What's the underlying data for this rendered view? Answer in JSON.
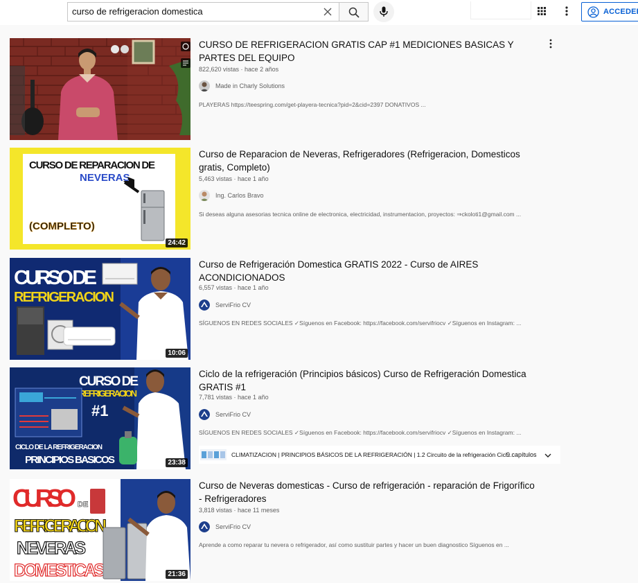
{
  "search": {
    "query": "curso de refrigeracion domestica"
  },
  "icons": {
    "clear": "close-icon",
    "search": "search-icon",
    "mic": "mic-icon",
    "apps": "apps-grid-icon",
    "more": "more-vert-icon",
    "account": "account-circle-icon"
  },
  "header": {
    "signin_label": "ACCEDER"
  },
  "colors": {
    "accent": "#065fd4",
    "meta": "#606060",
    "background": "#f9f9f9"
  },
  "results": [
    {
      "title": "CURSO DE REFRIGERACION GRATIS CAP #1 MEDICIONES BASICAS Y PARTES DEL EQUIPO",
      "views": "822,620 vistas",
      "age": "hace 2 años",
      "channel": "Made in Charly Solutions",
      "description": "PLAYERAS https://teespring.com/get-playera-tecnica?pid=2&cid=2397 DONATIVOS ...",
      "duration": ""
    },
    {
      "title": "Curso de Reparacion de Neveras, Refrigeradores (Refrigeracion, Domesticos gratis, Completo)",
      "views": "5,463 vistas",
      "age": "hace 1 año",
      "channel": "Ing. Carlos Bravo",
      "description": "Si deseas alguna asesorias tecnica online de electronica, electricidad, instrumentacion, proyectos: ⇒ckoloti1@gmail.com ...",
      "duration": "24:42",
      "thumb_text": {
        "line1": "CURSO DE REPARACION DE",
        "line2": "NEVERAS",
        "line3": "(COMPLETO)"
      }
    },
    {
      "title": "Curso de Refrigeración Domestica GRATIS 2022 - Curso de AIRES ACONDICIONADOS",
      "views": "6,557 vistas",
      "age": "hace 1 año",
      "channel": "ServiFrio CV",
      "description": "SÍGUENOS EN REDES SOCIALES ✓Síguenos en Facebook: https://facebook.com/servifriocv ✓Síguenos en Instagram: ...",
      "duration": "10:06",
      "thumb_text": {
        "line1": "CURSO DE",
        "line2": "REFRIGERACION"
      }
    },
    {
      "title": "Ciclo de la refrigeración (Principios básicos) Curso de Refrigeración Domestica GRATIS #1",
      "views": "7,781 vistas",
      "age": "hace 1 año",
      "channel": "ServiFrio CV",
      "description": "SÍGUENOS EN REDES SOCIALES ✓Síguenos en Facebook: https://facebook.com/servifriocv ✓Síguenos en Instagram: ...",
      "duration": "23:38",
      "chapters_text": "CLIMATIZACION | PRINCIPIOS BÁSICOS DE LA REFRIGERACIÓN | 1.2 Circuito de la refrigeración Cicl...",
      "chapters_count": "9 capítulos",
      "thumb_text": {
        "line1": "CURSO DE",
        "line2": "REFRIGERACION",
        "line3": "#1",
        "line4": "CICLO DE LA REFRIGERACION",
        "line5": "PRINCIPIOS BASICOS"
      }
    },
    {
      "title": "Curso de Neveras domesticas - Curso de refrigeración - reparación de Frigorífico - Refrigeradores",
      "views": "3,818 vistas",
      "age": "hace 11 meses",
      "channel": "ServiFrio CV",
      "description": "Aprende a como reparar tu nevera o refrigerador, así como sustituir partes y hacer un buen diagnostico Síguenos en ...",
      "duration": "21:36",
      "thumb_text": {
        "line1": "CURSO",
        "line2": "DE",
        "line3": "REFRIGERACION",
        "line4": "NEVERAS",
        "line5": "DOMESTICAS"
      }
    }
  ]
}
